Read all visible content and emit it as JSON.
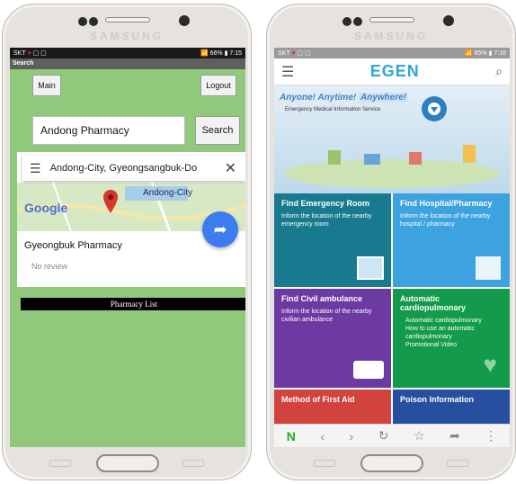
{
  "left_phone": {
    "brand": "SAMSUNG",
    "status": {
      "carrier": "SKT",
      "battery": "66%",
      "time": "7:15"
    },
    "window_title": "Search",
    "main_button": "Main",
    "logout_button": "Logout",
    "search_value": "Andong Pharmacy",
    "search_button": "Search",
    "address_value": "Andong-City, Gyeongsangbuk-Do",
    "map_logo": "Google",
    "map_label": "Andong-City",
    "result_name": "Gyeongbuk Pharmacy",
    "result_review": "No review",
    "pharmacy_list_label": "Pharmacy List"
  },
  "right_phone": {
    "brand": "SAMSUNG",
    "status": {
      "carrier": "SKT",
      "battery": "65%",
      "time": "7:16"
    },
    "logo_text": "EGEN",
    "banner_tagline": [
      "Anyone!",
      "Anytime!",
      "Anywhere!"
    ],
    "banner_subtitle": "Emergency Medical Information Service",
    "tiles": [
      {
        "title": "Find Emergency Room",
        "desc": "Inform the location of the nearby emergency room",
        "color": "#187a8e"
      },
      {
        "title": "Find Hospital/Pharmacy",
        "desc": "Inform the location of the nearby hospital / pharmacy",
        "color": "#3ca3e0"
      },
      {
        "title": "Find Civil ambulance",
        "desc": "Inform the location of the nearby civilian ambulance",
        "color": "#6c3aa0"
      },
      {
        "title": "Automatic cardiopulmonary",
        "desc_items": [
          "Automatic cardiopulmonary",
          "How to use an automatic cardiopulmonary",
          "Promotional Video"
        ],
        "color": "#139a4a"
      },
      {
        "title": "Method of First Aid",
        "color": "#d2433e"
      },
      {
        "title": "Poison Information",
        "color": "#264f9f"
      }
    ]
  },
  "colors": {
    "left_bg": "#90c97b",
    "map_pin": "#d9352b",
    "route_btn": "#3b7cf0"
  }
}
